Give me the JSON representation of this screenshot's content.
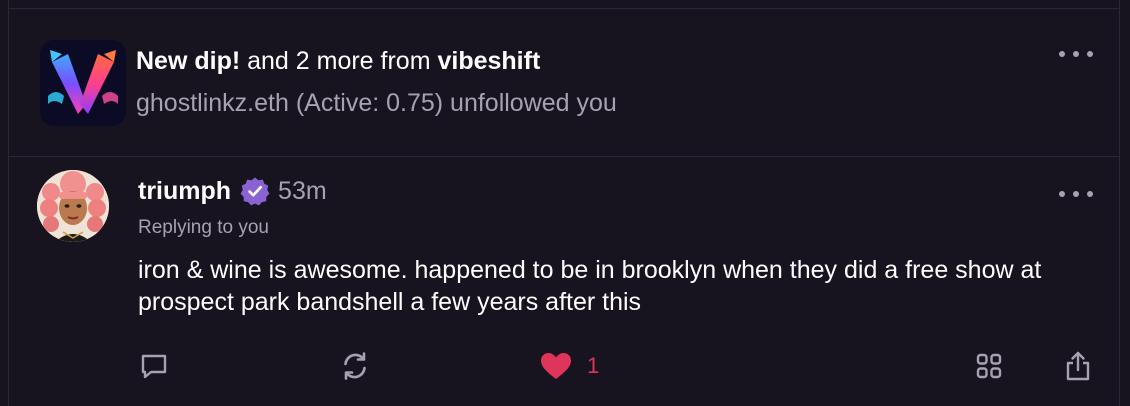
{
  "notification": {
    "title_bold": "New dip!",
    "title_mid": " and 2 more from ",
    "title_app": "vibeshift",
    "subtitle": "ghostlinkz.eth (Active: 0.75) unfollowed you",
    "app_icon": "vibeshift-logo",
    "menu_icon": "more-horizontal-icon"
  },
  "cast": {
    "author": "triumph",
    "verified_icon": "verified-badge-icon",
    "time": "53m",
    "reply_context": "Replying to you",
    "text": "iron & wine is awesome. happened to be in brooklyn when they did a free show at prospect park bandshell a few years after this",
    "menu_icon": "more-horizontal-icon",
    "actions": {
      "reply_icon": "comment-icon",
      "recast_icon": "recast-icon",
      "like_icon": "heart-icon",
      "like_count": "1",
      "grid_icon": "grid-icon",
      "share_icon": "share-icon"
    }
  },
  "colors": {
    "background": "#17131f",
    "border": "#2c2635",
    "muted_text": "#a7a1b1",
    "like_red": "#e0355a",
    "verified_purple": "#8a63d2"
  }
}
